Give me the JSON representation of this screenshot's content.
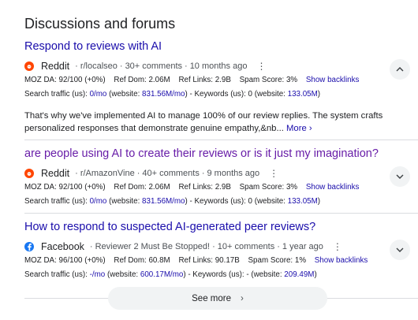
{
  "section_title": "Discussions and forums",
  "results": [
    {
      "title": "Respond to reviews with AI",
      "site": "Reddit",
      "meta1": "r/localseo",
      "meta2": "30+ comments",
      "meta3": "10 months ago",
      "moz_da": "MOZ DA: 92/100 (+0%)",
      "ref_dom": "Ref Dom: 2.06M",
      "ref_links": "Ref Links: 2.9B",
      "spam": "Spam Score: 3%",
      "backlinks": "Show backlinks",
      "traffic_label": "Search traffic (us):",
      "traffic_value": "0/mo",
      "website_label": "(website:",
      "website_value": "831.56M/mo",
      "kw_label": ") - Keywords (us): 0 (website:",
      "kw_value": "133.05M",
      "kw_close": ")",
      "snippet": "That's why we've implemented AI to manage 100% of our review replies. The system crafts personalized responses that demonstrate genuine empathy,&nb...",
      "more": "More"
    },
    {
      "title": "are people using AI to create their reviews or is it just my imagination?",
      "site": "Reddit",
      "meta1": "r/AmazonVine",
      "meta2": "40+ comments",
      "meta3": "9 months ago",
      "moz_da": "MOZ DA: 92/100 (+0%)",
      "ref_dom": "Ref Dom: 2.06M",
      "ref_links": "Ref Links: 2.9B",
      "spam": "Spam Score: 3%",
      "backlinks": "Show backlinks",
      "traffic_label": "Search traffic (us):",
      "traffic_value": "0/mo",
      "website_label": "(website:",
      "website_value": "831.56M/mo",
      "kw_label": ") - Keywords (us): 0 (website:",
      "kw_value": "133.05M",
      "kw_close": ")"
    },
    {
      "title": "How to respond to suspected AI-generated peer reviews?",
      "site": "Facebook",
      "meta1": "Reviewer 2 Must Be Stopped!",
      "meta2": "10+ comments",
      "meta3": "1 year ago",
      "moz_da": "MOZ DA: 96/100 (+0%)",
      "ref_dom": "Ref Dom: 60.8M",
      "ref_links": "Ref Links: 90.17B",
      "spam": "Spam Score: 1%",
      "backlinks": "Show backlinks",
      "traffic_label": "Search traffic (us):",
      "traffic_value": "-/mo",
      "website_label": "(website:",
      "website_value": "600.17M/mo",
      "kw_label": ") - Keywords (us): - (website:",
      "kw_value": "209.49M",
      "kw_close": ")"
    }
  ],
  "see_more": "See more",
  "colors": {
    "link": "#1a0dab",
    "visited": "#681da8",
    "reddit": "#ff4500",
    "facebook": "#1877f2"
  },
  "icons": [
    "reddit-icon",
    "facebook-icon",
    "more-vert-icon",
    "chevron-up-icon",
    "chevron-down-icon",
    "chevron-right-icon"
  ]
}
